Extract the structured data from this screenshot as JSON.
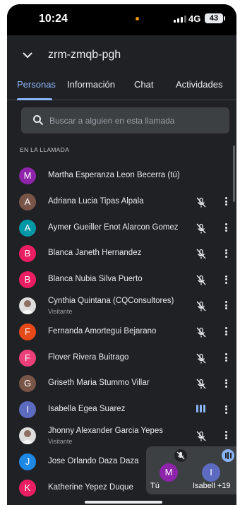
{
  "status": {
    "time": "10:24",
    "network": "4G",
    "battery": "43"
  },
  "header": {
    "title": "zrm-zmqb-pgh"
  },
  "tabs": [
    {
      "label": "Personas"
    },
    {
      "label": "Información"
    },
    {
      "label": "Chat"
    },
    {
      "label": "Actividades"
    }
  ],
  "search": {
    "placeholder": "Buscar a alguien en esta llamada"
  },
  "section_label": "EN LA LLAMADA",
  "participants": [
    {
      "initial": "M",
      "name": "Martha Esperanza Leon Becerra (tú)",
      "sub": "",
      "color": "#8e24aa",
      "state": "none"
    },
    {
      "initial": "A",
      "name": "Adriana Lucia Tipas Alpala",
      "sub": "",
      "color": "#795548",
      "state": "muted"
    },
    {
      "initial": "A",
      "name": "Aymer Gueiller Enot Alarcon Gomez",
      "sub": "",
      "color": "#0097a7",
      "state": "muted"
    },
    {
      "initial": "B",
      "name": "Blanca Janeth Hernandez",
      "sub": "",
      "color": "#e91e63",
      "state": "muted"
    },
    {
      "initial": "B",
      "name": "Blanca Nubia Silva Puerto",
      "sub": "",
      "color": "#e91e63",
      "state": "muted"
    },
    {
      "initial": "",
      "name": "Cynthia Quintana (CQConsultores)",
      "sub": "Visitante",
      "color": "#d7ccc8",
      "state": "muted"
    },
    {
      "initial": "F",
      "name": "Fernanda Amortegui Bejarano",
      "sub": "",
      "color": "#e64a19",
      "state": "muted"
    },
    {
      "initial": "F",
      "name": "Flover Rivera Buitrago",
      "sub": "",
      "color": "#ec407a",
      "state": "muted"
    },
    {
      "initial": "G",
      "name": "Griseth Maria Stummo Villar",
      "sub": "",
      "color": "#795548",
      "state": "muted"
    },
    {
      "initial": "I",
      "name": "Isabella Egea Suarez",
      "sub": "",
      "color": "#5c6bc0",
      "state": "speaking"
    },
    {
      "initial": "",
      "name": "Jhonny Alexander Garcia Yepes",
      "sub": "Visitante",
      "color": "#eeeeee",
      "state": "muted"
    },
    {
      "initial": "J",
      "name": "Jose Orlando Daza Daza",
      "sub": "",
      "color": "#1e88e5",
      "state": "none"
    },
    {
      "initial": "K",
      "name": "Katherine Yepez Duque",
      "sub": "",
      "color": "#e91e63",
      "state": "none"
    }
  ],
  "pip": {
    "self": {
      "initial": "M",
      "label": "Tú",
      "color": "#8e24aa"
    },
    "other": {
      "initial": "I",
      "label": "Isabell",
      "extra": "+19",
      "color": "#5c6bc0"
    }
  }
}
